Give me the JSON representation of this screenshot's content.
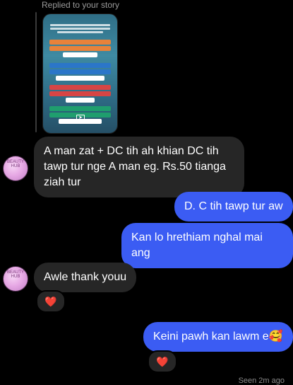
{
  "thread": {
    "replied_label": "Replied to your story",
    "seen_label": "Seen 2m ago",
    "messages": [
      {
        "side": "left",
        "text": "A man zat + DC tih ah khian DC tih tawp tur nge A man eg. Rs.50 tianga ziah tur"
      },
      {
        "side": "right",
        "text": "D. C tih tawp tur aw"
      },
      {
        "side": "right",
        "text": "Kan lo hrethiam nghal mai ang"
      },
      {
        "side": "left",
        "text": "Awle thank youu"
      },
      {
        "side": "right",
        "text": "Keini pawh kan lawm e🥰"
      }
    ],
    "reactions": [
      "❤️",
      "❤️"
    ],
    "avatar_text": "BEAUTY HUB"
  },
  "colors": {
    "background": "#000000",
    "incoming_bubble": "#262626",
    "outgoing_bubble": "#3b5cf3",
    "muted_text": "#9a9a9a"
  }
}
